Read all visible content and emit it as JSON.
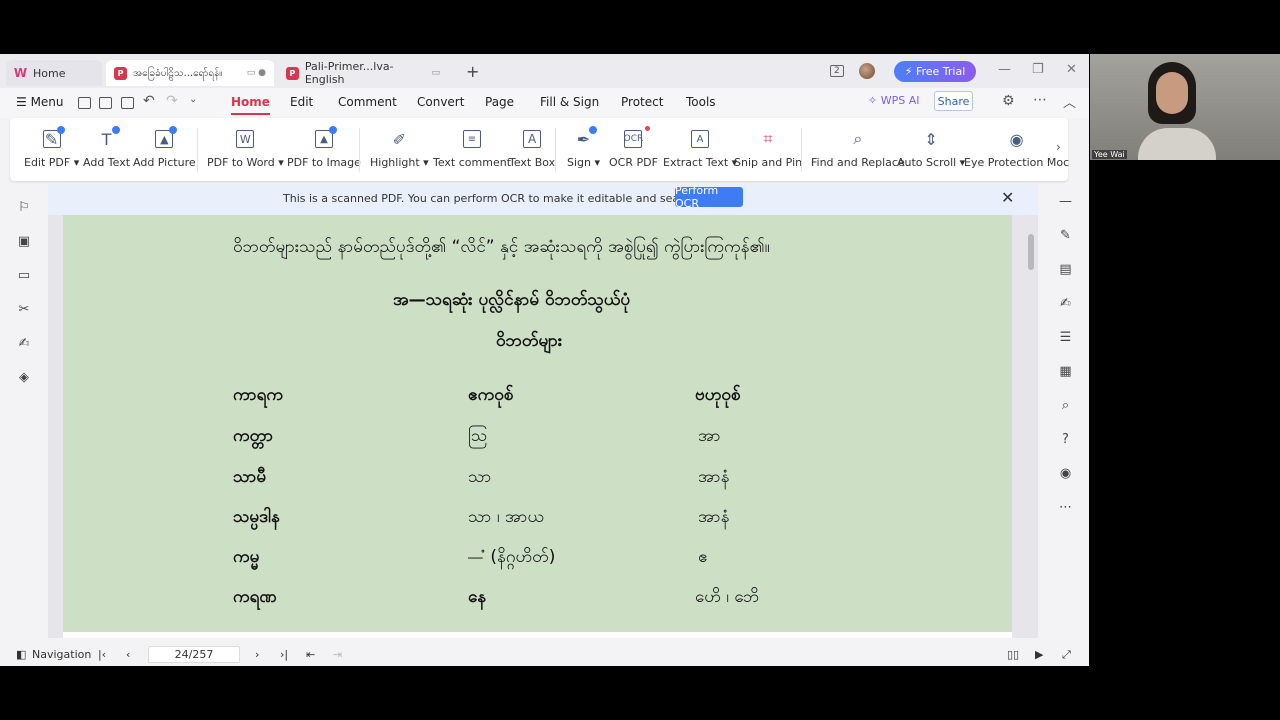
{
  "tabs": {
    "home": "Home",
    "active": "အခြေခံပါဠိသ...ရော်ရန်။",
    "third": "Pali-Primer...lva-English",
    "plus": "+"
  },
  "titlebar": {
    "badge": "2",
    "free_trial": "⚡ Free Trial",
    "minimize": "—",
    "restore": "❐",
    "close": "✕"
  },
  "menubar": {
    "menu": "☰  Menu",
    "items": [
      "Home",
      "Edit",
      "Comment",
      "Convert",
      "Page",
      "Fill & Sign",
      "Protect",
      "Tools"
    ],
    "wps_ai": "✧ WPS AI",
    "share": "Share"
  },
  "ribbon": {
    "tools": [
      {
        "label": "Edit PDF ▾",
        "icon": "edit-pdf-icon"
      },
      {
        "label": "Add Text",
        "icon": "add-text-icon"
      },
      {
        "label": "Add Picture",
        "icon": "add-picture-icon"
      },
      {
        "label": "PDF to Word ▾",
        "icon": "pdf-to-word-icon"
      },
      {
        "label": "PDF to Image",
        "icon": "pdf-to-image-icon"
      },
      {
        "label": "Highlight ▾",
        "icon": "highlight-icon"
      },
      {
        "label": "Text comment",
        "icon": "text-comment-icon"
      },
      {
        "label": "Text Box",
        "icon": "text-box-icon"
      },
      {
        "label": "Sign ▾",
        "icon": "sign-icon"
      },
      {
        "label": "OCR PDF",
        "icon": "ocr-pdf-icon"
      },
      {
        "label": "Extract Text ▾",
        "icon": "extract-text-icon"
      },
      {
        "label": "Snip and Pin",
        "icon": "snip-pin-icon"
      },
      {
        "label": "Find and Replace",
        "icon": "find-replace-icon"
      },
      {
        "label": "Auto Scroll ▾",
        "icon": "auto-scroll-icon"
      },
      {
        "label": "Eye Protection Moc",
        "icon": "eye-protection-icon"
      }
    ]
  },
  "ocr_bar": {
    "message": "This is a scanned PDF. You can perform OCR to make it editable and searchable.",
    "button": "Perform OCR",
    "close": "✕"
  },
  "document": {
    "line1": "ဝိဘတ်များသည်  နာမ်တည်ပုဒ်တို့၏ “လိင်” နှင့် အဆုံးသရကို အစွဲပြု၍ ကွဲပြားကြကုန်၏။",
    "heading1": "အ—သရဆုံး  ပုလ္လိင်နာမ်  ဝိဘတ်သွယ်ပုံ",
    "heading2": "ဝိဘတ်များ",
    "col1_header": "ကာရက",
    "col2_header": "ဧကဝုစ်",
    "col3_header": "ဗဟုဝုစ်",
    "rows": [
      {
        "c1": "ကတ္တာ",
        "c2": "ဩ",
        "c3": "အာ"
      },
      {
        "c1": "သာမီ",
        "c2": "သာ",
        "c3": "အာနံ"
      },
      {
        "c1": "သမ္ပဒါန",
        "c2": "သာ  ၊  အာယ",
        "c3": "အာနံ"
      },
      {
        "c1": "ကမ္မ",
        "c2": "—ံ  (နိဂ္ဂဟိတ်)",
        "c3": "ဧ"
      },
      {
        "c1": "ကရဏ",
        "c2": "နေ",
        "c3": "ဟေိ  ၊  ဘေိ"
      }
    ]
  },
  "statusbar": {
    "navigation": "Navigation",
    "page": "24/257"
  },
  "webcam": {
    "name": "Yee Wai"
  }
}
